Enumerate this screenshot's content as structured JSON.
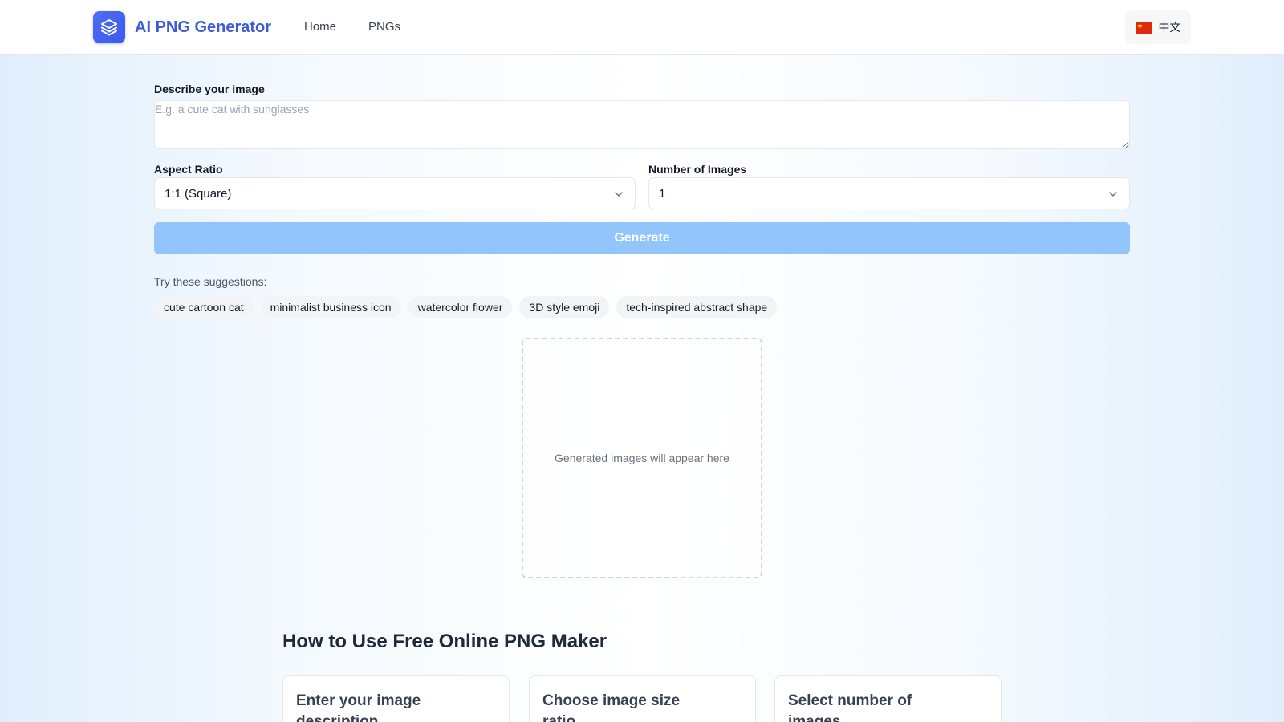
{
  "header": {
    "brand": "AI PNG Generator",
    "nav": [
      "Home",
      "PNGs"
    ],
    "language": "中文"
  },
  "form": {
    "describe_label": "Describe your image",
    "describe_placeholder": "E.g. a cute cat with sunglasses",
    "aspect_label": "Aspect Ratio",
    "aspect_value": "1:1 (Square)",
    "count_label": "Number of Images",
    "count_value": "1",
    "generate_label": "Generate"
  },
  "suggestions": {
    "label": "Try these suggestions:",
    "items": [
      "cute cartoon cat",
      "minimalist business icon",
      "watercolor flower",
      "3D style emoji",
      "tech-inspired abstract shape"
    ]
  },
  "output": {
    "placeholder": "Generated images will appear here"
  },
  "how_to": {
    "title": "How to Use Free Online PNG Maker",
    "steps": [
      "Enter your image description",
      "Choose image size ratio",
      "Select number of images"
    ]
  },
  "colors": {
    "accent": "#3b5bdb",
    "button_disabled": "#93c5fd"
  }
}
